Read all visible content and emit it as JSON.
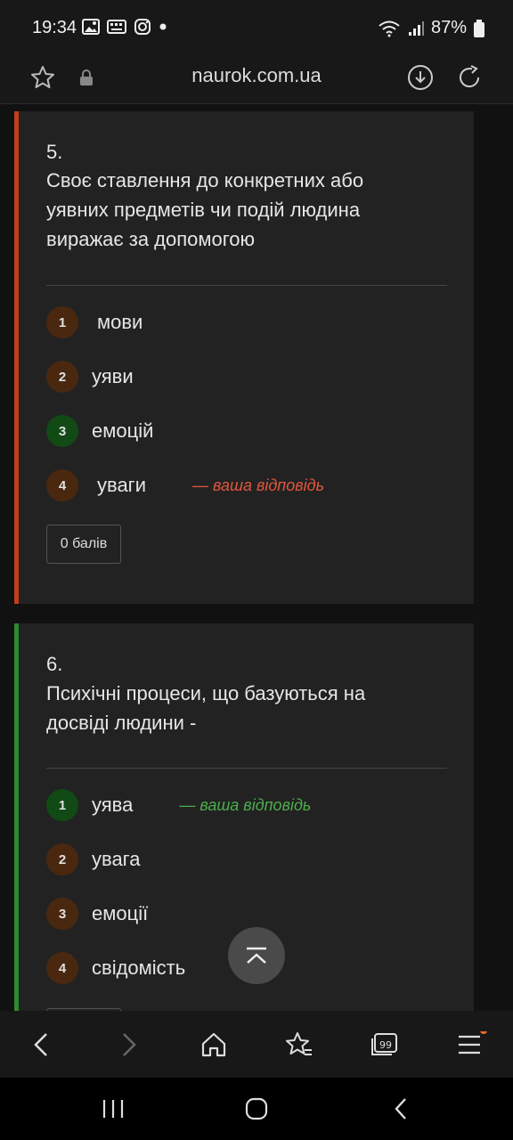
{
  "status_bar": {
    "time": "19:34",
    "battery": "87%"
  },
  "browser": {
    "url": "naurok.com.ua"
  },
  "colors": {
    "wrong": "#c0401a",
    "correct": "#2e8a2e",
    "your_answer_wrong": "#e2563c",
    "your_answer_correct": "#4cae4c"
  },
  "questions": [
    {
      "number": "5.",
      "text": "Своє ставлення до конкретних або уявних предметів чи подій людина виражає за допомогою",
      "options": [
        {
          "num": "1",
          "label": "мови",
          "state": "neutral"
        },
        {
          "num": "2",
          "label": "уяви",
          "state": "neutral"
        },
        {
          "num": "3",
          "label": "емоцій",
          "state": "correct"
        },
        {
          "num": "4",
          "label": "уваги",
          "state": "neutral"
        }
      ],
      "your_answer_label": "— ваша відповідь",
      "score": "0 балів"
    },
    {
      "number": "6.",
      "text": "Психічні процеси, що базуються на досвіді людини -",
      "options": [
        {
          "num": "1",
          "label": "уява",
          "state": "correct"
        },
        {
          "num": "2",
          "label": "увага",
          "state": "neutral"
        },
        {
          "num": "3",
          "label": "емоції",
          "state": "neutral"
        },
        {
          "num": "4",
          "label": "свідомість",
          "state": "neutral"
        }
      ],
      "your_answer_label": "— ваша відповідь"
    }
  ]
}
